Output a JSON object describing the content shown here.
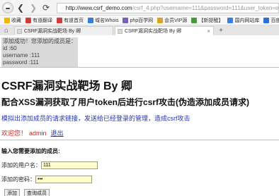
{
  "browser": {
    "url_host": "http://www.csrf_demo.com",
    "url_rest": "/csrf_4.php?username=111&password=111&user_token=e1f5a1f5a8",
    "bookmarks": [
      "",
      "收藏",
      "有道翻译",
      "有道首页",
      "域名Whois",
      "php百学网",
      "会员VIP源",
      "【新提醒】",
      "国内网站库",
      "百度一下"
    ],
    "tabs": [
      {
        "title": "CSRF漏洞实战靶场 By 卿",
        "active": false
      },
      {
        "title": "CSRF漏洞实战靶场 By 卿",
        "active": true
      }
    ]
  },
  "alert": {
    "line1": "添加成功！您添加的成员是：",
    "line2": "id :60",
    "line3": "username :111",
    "line4": "password :111"
  },
  "page": {
    "title": "CSRF漏洞实战靶场 By 卿",
    "subtitle": "配合XSS漏洞获取了用户token后进行csrf攻击(伪造添加成员请求)",
    "description": "模拟出添加成员的请求链接，发送给已经登录的管理，造成csrf攻击",
    "welcome_text": "欢迎您！",
    "username": "admin",
    "logout_label": "退出",
    "form_title": "输入您需要添加的成员:",
    "username_label": "添加的用户名：",
    "username_value": "111",
    "password_label": "添加的密码：",
    "password_value": "•••",
    "submit_label": "添加",
    "query_label": "查询成员"
  },
  "colors": {
    "link_blue": "#2233bb",
    "welcome_red": "#d21f1f",
    "input_yellow": "#fffdcc"
  }
}
